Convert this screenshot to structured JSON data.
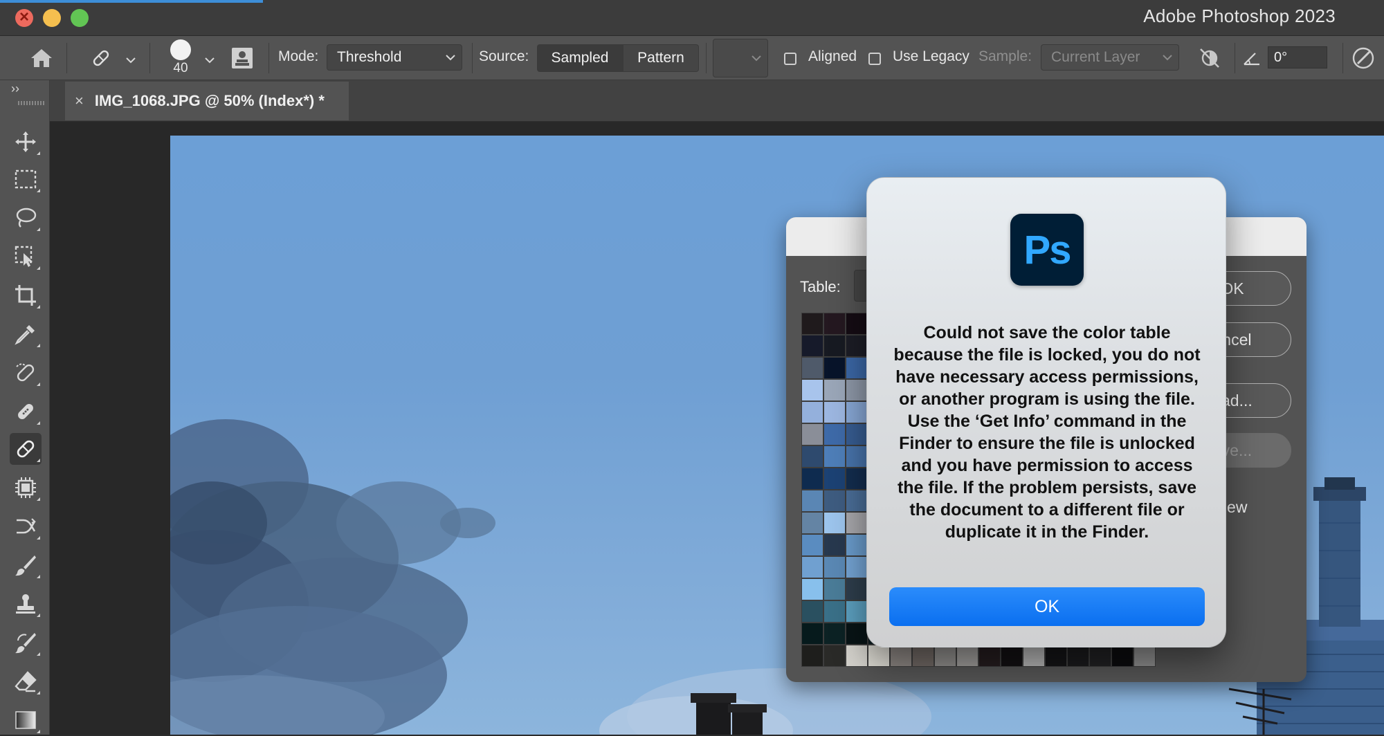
{
  "window": {
    "title": "Adobe Photoshop 2023"
  },
  "options_bar": {
    "brush_size": "40",
    "mode_label": "Mode:",
    "mode_value": "Threshold",
    "source_label": "Source:",
    "source_sampled": "Sampled",
    "source_pattern": "Pattern",
    "aligned_label": "Aligned",
    "use_legacy_label": "Use Legacy",
    "sample_label": "Sample:",
    "sample_value": "Current Layer",
    "angle_value": "0°"
  },
  "document_tab": {
    "title": "IMG_1068.JPG @ 50% (Index*) *",
    "close": "×"
  },
  "toolbar": {
    "collapse": "››",
    "tools": [
      "move-tool",
      "rectangular-marquee-tool",
      "lasso-tool",
      "object-selection-tool",
      "crop-tool",
      "eyedropper-tool",
      "spot-healing-brush-tool",
      "healing-brush-tool",
      "patch-tool",
      "content-aware-move-tool",
      "red-eye-tool",
      "brush-tool",
      "clone-stamp-tool",
      "history-brush-tool",
      "eraser-tool",
      "gradient-tool"
    ],
    "active_tool": "patch-tool"
  },
  "color_table_dialog": {
    "table_label": "Table:",
    "ok_label": "OK",
    "cancel_label": "ancel",
    "load_label": "oad...",
    "save_label": "ave...",
    "preview_label": "review",
    "swatches": [
      "#1f1a1c",
      "#241820",
      "#150c14",
      "#1d1b20",
      "#1b1c22",
      "#2b2226",
      "#1d1719",
      "#1b1a1b",
      "#222228",
      "#19171a",
      "#252029",
      "#1e1c1f",
      "#262427",
      "#1c1a1d",
      "#20202b",
      "#17171c",
      "#161a2a",
      "#171a22",
      "#1c1d26",
      "#222536",
      "#1c2030",
      "#18192a",
      "#121620",
      "#1a1d2a",
      "#20232f",
      "#141826",
      "#1b1f2b",
      "#151a28",
      "#262a3a",
      "#1d2130",
      "#1a1f2d",
      "#12141c",
      "#4f5a6a",
      "#08142a",
      "#3b67a6",
      "#3e6aa8",
      "#5f7a9a",
      "#445468",
      "#3a4860",
      "#566a86",
      "#4c6285",
      "#2c3e58",
      "#5a7090",
      "#4d6078",
      "#3a5070",
      "#6a7d98",
      "#2f4460",
      "#3e5372",
      "#a8c4ec",
      "#9aa6b8",
      "#8e98a8",
      "#a0b4cc",
      "#98aac2",
      "#7d8ea6",
      "#b2c2d6",
      "#8c9cb2",
      "#a6b8d0",
      "#95a8c0",
      "#889ab4",
      "#a0aec6",
      "#b8c6da",
      "#9cb0c8",
      "#8ea4be",
      "#a4b6cc",
      "#94b0dc",
      "#9cb6e0",
      "#88a8d6",
      "#7e9cc8",
      "#8aa6d0",
      "#96b0d8",
      "#84a0cc",
      "#90aad4",
      "#7a96c2",
      "#8ca8d2",
      "#9ab2da",
      "#86a2ce",
      "#92acd6",
      "#7e9ac6",
      "#8aa4cc",
      "#96aed4",
      "#8a8e98",
      "#3e6aa8",
      "#375d92",
      "#4470b0",
      "#3c649e",
      "#4a76b4",
      "#3a6098",
      "#466eac",
      "#3e669e",
      "#4872b0",
      "#3a6296",
      "#446cab",
      "#4070a6",
      "#3c68a0",
      "#4a74b2",
      "#3e6aa4",
      "#2e4a6e",
      "#4e7eb8",
      "#4874ac",
      "#527eba",
      "#4a78b2",
      "#567fbd",
      "#4c78b0",
      "#5480bc",
      "#4e7ab4",
      "#5882be",
      "#4a76ae",
      "#527eb8",
      "#4e78b2",
      "#5480bb",
      "#4a74ae",
      "#5a84c0",
      "#0e2b4f",
      "#1c4274",
      "#132d4f",
      "#1a3a66",
      "#163460",
      "#1e426e",
      "#123056",
      "#1a3c68",
      "#16355e",
      "#204470",
      "#14325a",
      "#1c3e6a",
      "#183862",
      "#22466e",
      "#143258",
      "#1e406c",
      "#5a86b4",
      "#3e5c80",
      "#4a6e98",
      "#54789e",
      "#46688e",
      "#5880a8",
      "#4a6e94",
      "#527aa2",
      "#486a90",
      "#5a82aa",
      "#4c7098",
      "#567ea4",
      "#4a6c92",
      "#5c84ac",
      "#4e7296",
      "#587ea6",
      "#6484a4",
      "#9cc4ec",
      "#a8a8ac",
      "#94b8e0",
      "#a0c0e4",
      "#9ab4d4",
      "#a6c2e2",
      "#98b6d8",
      "#a2c0e0",
      "#96b2d2",
      "#a8c4e4",
      "#9cb8d8",
      "#a4c0e0",
      "#98b4d6",
      "#a6c4e4",
      "#9ab6d6",
      "#5a8cc0",
      "#27384e",
      "#6a9ccc",
      "#5e8ec2",
      "#6696c8",
      "#5a8abc",
      "#6898ca",
      "#5c8cbe",
      "#6494c6",
      "#5888ba",
      "#6a9acc",
      "#5e8ec0",
      "#6696c8",
      "#5a8abc",
      "#6898c8",
      "#5c8cbe",
      "#70a0d0",
      "#5a88b4",
      "#74a4d4",
      "#6c9ccc",
      "#72a2d2",
      "#6a9ac8",
      "#76a6d6",
      "#6e9ece",
      "#74a4d2",
      "#6c9cca",
      "#78a8d8",
      "#70a0d0",
      "#74a4d4",
      "#6a9ac8",
      "#76a6d6",
      "#6e9ecc",
      "#88c0ec",
      "#4a7c98",
      "#2e3e4c",
      "#80b6e0",
      "#86bce6",
      "#7eb2dc",
      "#8abeea",
      "#82b8e2",
      "#88bce8",
      "#7eb4de",
      "#8cc0ec",
      "#84bae4",
      "#88bee8",
      "#80b6e0",
      "#8cc2ec",
      "#84bae2",
      "#2a5060",
      "#3a7088",
      "#5ca0c0",
      "#3c6e84",
      "#4a86a0",
      "#366478",
      "#4e8aa4",
      "#3a6c80",
      "#4884a0",
      "#34627a",
      "#508ca8",
      "#3c6e86",
      "#4a86a2",
      "#38687e",
      "#4e8aa6",
      "#3c6c84",
      "#061a1c",
      "#0c2224",
      "#081416",
      "#0e1e22",
      "#0a181a",
      "#102226",
      "#0a1a1c",
      "#0e2024",
      "#081618",
      "#0c1e20",
      "#0a181c",
      "#102428",
      "#0a1a1e",
      "#0e2226",
      "#08181a",
      "#0c1c20",
      "#1e1e1c",
      "#2a2a28",
      "#d4d2cc",
      "#dcdad2",
      "#8a8480",
      "#6e6662",
      "#8c8a88",
      "#9a9896",
      "#241c1e",
      "#121012",
      "#b0b0b0",
      "#141416",
      "#1a1a1c",
      "#202022",
      "#0c0c0e",
      "#8a8a8a"
    ]
  },
  "alert": {
    "logo_text": "Ps",
    "message": "Could not save the color table because the file is locked, you do not have necessary access permissions, or another program is using the file. Use the ‘Get Info’ command in the Finder to ensure the file is unlocked and you have permission to access the file. If the problem persists, save the document to a different file or duplicate it in the Finder.",
    "ok_label": "OK"
  },
  "colors": {
    "accent_blue": "#0a6ff0",
    "ps_logo_bg": "#001e36",
    "ps_logo_text": "#31a8ff"
  }
}
